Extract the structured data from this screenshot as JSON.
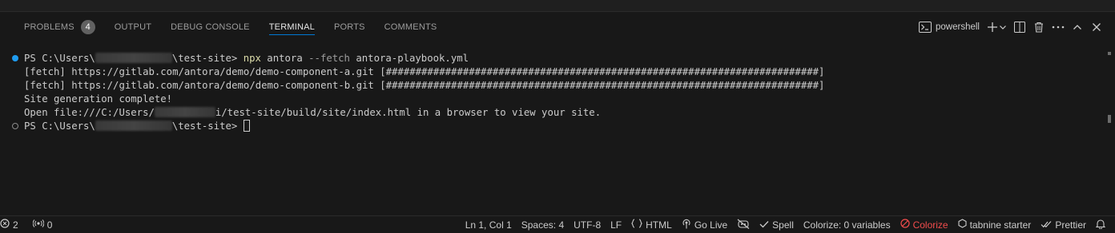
{
  "panel": {
    "tabs": [
      {
        "label": "PROBLEMS",
        "badge": "4"
      },
      {
        "label": "OUTPUT"
      },
      {
        "label": "DEBUG CONSOLE"
      },
      {
        "label": "TERMINAL",
        "active": true
      },
      {
        "label": "PORTS"
      },
      {
        "label": "COMMENTS"
      }
    ],
    "shell_label": "powershell"
  },
  "terminal": {
    "prompt_prefix": "PS C:\\Users\\",
    "prompt_suffix": "\\test-site>",
    "command": {
      "exe": "npx",
      "args1": " antora ",
      "flag": "--fetch",
      "args2": " antora-playbook.yml"
    },
    "fetch_a": "[fetch] https://gitlab.com/antora/demo/demo-component-a.git [#########################################################################]",
    "fetch_b": "[fetch] https://gitlab.com/antora/demo/demo-component-b.git [#########################################################################]",
    "complete": "Site generation complete!",
    "open_prefix": "Open file:///C:/Users/",
    "open_suffix": "i/test-site/build/site/index.html in a browser to view your site."
  },
  "statusbar": {
    "errors": "2",
    "warnings": "0",
    "position": "Ln 1, Col 1",
    "spaces": "Spaces: 4",
    "encoding": "UTF-8",
    "eol": "LF",
    "language": "HTML",
    "golive": "Go Live",
    "spell": "Spell",
    "colorize_vars": "Colorize: 0 variables",
    "colorize": "Colorize",
    "tabnine": "tabnine starter",
    "prettier": "Prettier"
  },
  "colors": {
    "accent": "#0078d4",
    "error": "#f14c4c",
    "decoration": "#1f9cf0"
  }
}
